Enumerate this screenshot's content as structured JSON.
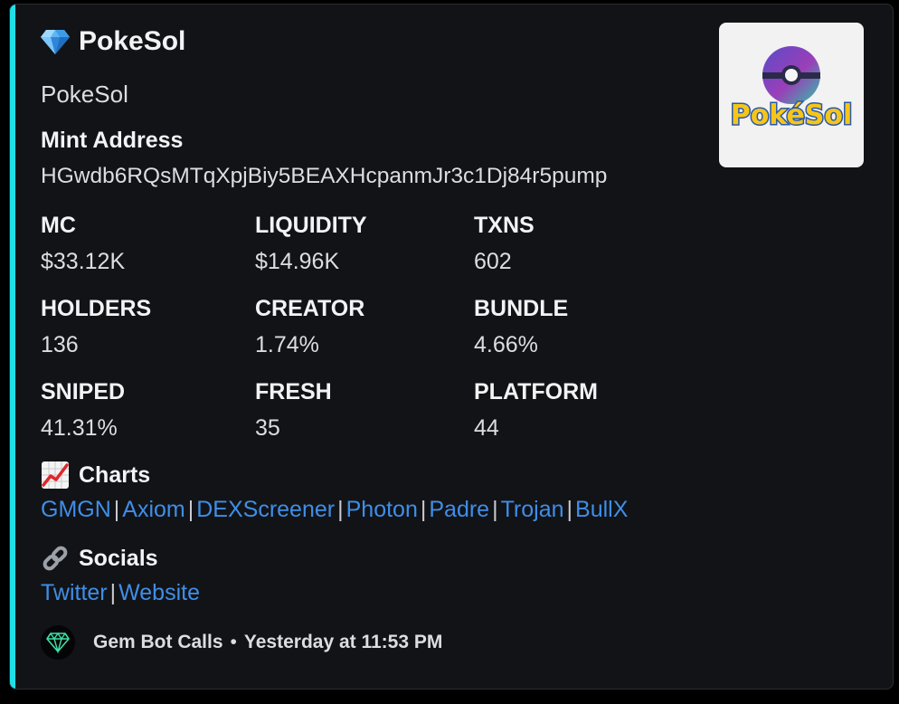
{
  "embed": {
    "accent_color": "#1fe0e8",
    "title": "PokeSol",
    "title_icon": "gem-icon",
    "subtitle": "PokeSol",
    "thumbnail": {
      "icon": "pokesol-logo",
      "logo_text": "PokéSol"
    },
    "mint_address_label": "Mint Address",
    "mint_address": "HGwdb6RQsMTqXpjBiy5BEAXHcpanmJr3c1Dj84r5pump",
    "stats": [
      {
        "label": "MC",
        "value": "$33.12K"
      },
      {
        "label": "LIQUIDITY",
        "value": "$14.96K"
      },
      {
        "label": "TXNS",
        "value": "602"
      },
      {
        "label": "HOLDERS",
        "value": "136"
      },
      {
        "label": "CREATOR",
        "value": "1.74%"
      },
      {
        "label": "BUNDLE",
        "value": "4.66%"
      },
      {
        "label": "SNIPED",
        "value": "41.31%"
      },
      {
        "label": "FRESH",
        "value": "35"
      },
      {
        "label": "PLATFORM",
        "value": "44"
      }
    ],
    "charts": {
      "header": "Charts",
      "icon": "chart-increasing-icon",
      "links": [
        "GMGN",
        "Axiom",
        "DEXScreener",
        "Photon",
        "Padre",
        "Trojan",
        "BullX"
      ],
      "separator": "|"
    },
    "socials": {
      "header": "Socials",
      "icon": "link-icon",
      "links": [
        "Twitter",
        "Website"
      ],
      "separator": "|"
    },
    "footer": {
      "bot_name": "Gem Bot Calls",
      "dot": "•",
      "timestamp": "Yesterday at 11:53 PM",
      "avatar_icon": "gem-avatar-icon"
    }
  },
  "colors": {
    "background": "#121316",
    "link": "#3f8ee8",
    "label": "#f2f3f5",
    "text": "#dbdee1"
  }
}
